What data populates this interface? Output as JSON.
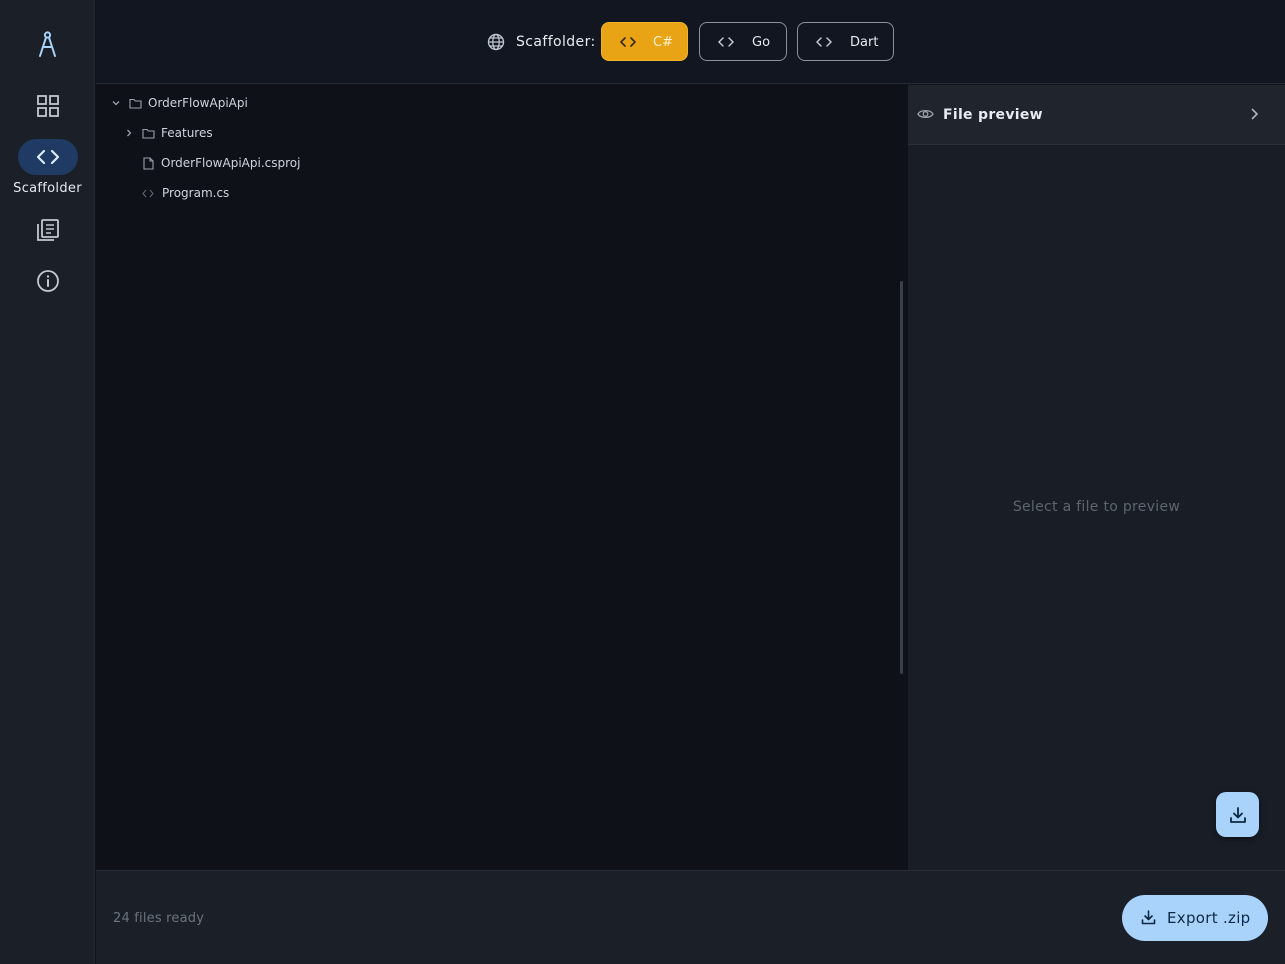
{
  "nav": {
    "logo_icon": "compass-icon",
    "items": [
      {
        "icon": "grid-icon",
        "label": "",
        "active": false
      },
      {
        "icon": "code-icon",
        "label": "Scaffolder",
        "active": true
      },
      {
        "icon": "library-icon",
        "label": "",
        "active": false
      },
      {
        "icon": "info-icon",
        "label": "",
        "active": false
      }
    ]
  },
  "header": {
    "icon": "globe-icon",
    "label": "Scaffolder:",
    "languages": [
      {
        "label": "C#",
        "selected": true
      },
      {
        "label": "Go",
        "selected": false
      },
      {
        "label": "Dart",
        "selected": false
      }
    ]
  },
  "tree": [
    {
      "name": "OrderFlowApiApi",
      "type": "folder",
      "expanded": true
    },
    {
      "name": "Features",
      "type": "folder",
      "expanded": false
    },
    {
      "name": "OrderFlowApiApi.csproj",
      "type": "file"
    },
    {
      "name": "Program.cs",
      "type": "code-file"
    }
  ],
  "preview": {
    "title": "File preview",
    "placeholder": "Select a file to preview"
  },
  "footer": {
    "status": "24 files ready",
    "export_label": "Export .zip"
  },
  "colors": {
    "accent": "#e8a414",
    "primary_light": "#a9d3fb",
    "background": "#0f131a",
    "rail_active": "#1f3b63"
  }
}
